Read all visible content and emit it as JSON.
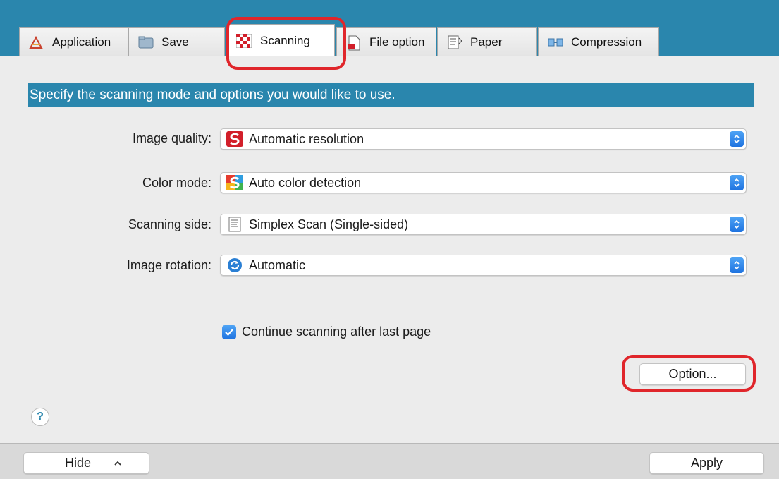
{
  "tabs": [
    {
      "label": "Application",
      "icon": "application-icon"
    },
    {
      "label": "Save",
      "icon": "folder-icon"
    },
    {
      "label": "Scanning",
      "icon": "scanning-icon"
    },
    {
      "label": "File option",
      "icon": "file-icon"
    },
    {
      "label": "Paper",
      "icon": "paper-icon"
    },
    {
      "label": "Compression",
      "icon": "compression-icon"
    }
  ],
  "active_tab": "Scanning",
  "banner": "Specify the scanning mode and options you would like to use.",
  "settings": {
    "image_quality": {
      "label": "Image quality:",
      "value": "Automatic resolution"
    },
    "color_mode": {
      "label": "Color mode:",
      "value": "Auto color detection"
    },
    "scanning_side": {
      "label": "Scanning side:",
      "value": "Simplex Scan (Single-sided)"
    },
    "image_rotation": {
      "label": "Image rotation:",
      "value": "Automatic"
    }
  },
  "continue_scanning": {
    "label": "Continue scanning after last page",
    "checked": true
  },
  "option_button": "Option...",
  "help_button": "?",
  "footer": {
    "hide_label": "Hide",
    "apply_label": "Apply"
  },
  "colors": {
    "accent": "#2a86ad",
    "highlight": "#e0262b",
    "checkbox": "#1f73e0"
  }
}
